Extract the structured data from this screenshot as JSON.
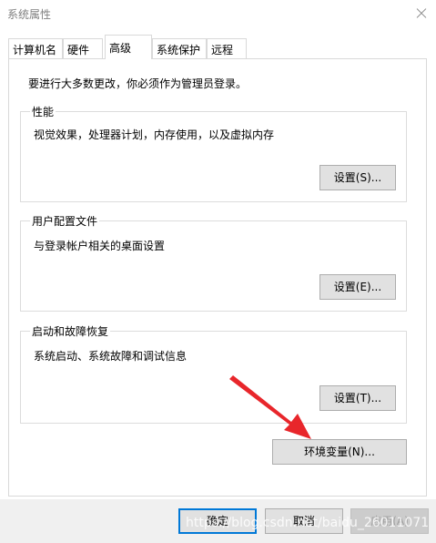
{
  "window": {
    "title": "系统属性"
  },
  "tabs": [
    {
      "label": "计算机名"
    },
    {
      "label": "硬件"
    },
    {
      "label": "高级"
    },
    {
      "label": "系统保护"
    },
    {
      "label": "远程"
    }
  ],
  "advanced": {
    "intro": "要进行大多数更改，你必须作为管理员登录。",
    "performance": {
      "label": "性能",
      "description": "视觉效果，处理器计划，内存使用，以及虚拟内存",
      "button": "设置(S)..."
    },
    "profiles": {
      "label": "用户配置文件",
      "description": "与登录帐户相关的桌面设置",
      "button": "设置(E)..."
    },
    "startup": {
      "label": "启动和故障恢复",
      "description": "系统启动、系统故障和调试信息",
      "button": "设置(T)..."
    },
    "env_button": "环境变量(N)..."
  },
  "footer": {
    "ok": "确定",
    "cancel": "取消",
    "apply": "应用(A)"
  },
  "watermark": "https://blog.csdn.net/baidu_26011071",
  "colors": {
    "accent": "#0078d7",
    "arrow": "#e8262b"
  }
}
